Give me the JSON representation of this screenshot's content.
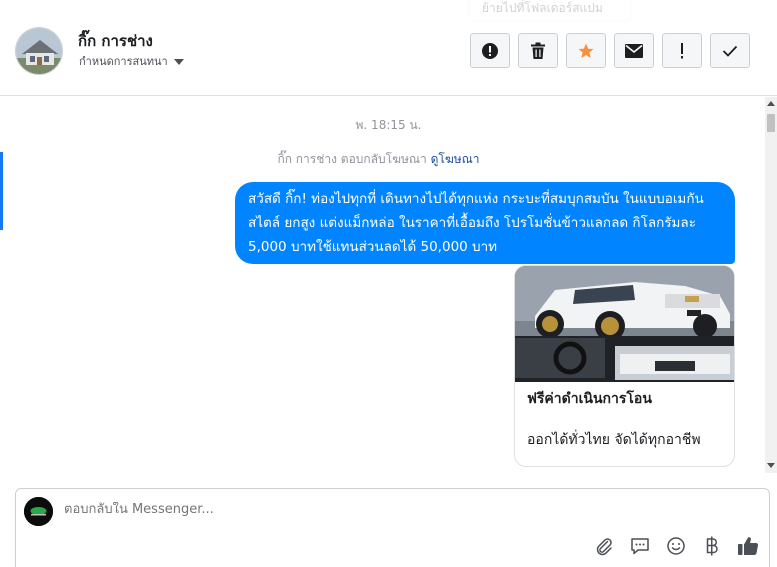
{
  "header": {
    "contact_name": "กิ๊ก การช่าง",
    "conversation_menu_label": "กำหนดการสนทนา",
    "tooltip_text": "ย้ายไปที่โฟลเดอร์สแปม"
  },
  "actions": [
    {
      "name": "report",
      "icon": "exclamation-circle-icon"
    },
    {
      "name": "delete",
      "icon": "trash-icon"
    },
    {
      "name": "star",
      "icon": "star-icon",
      "color": "#f7923b"
    },
    {
      "name": "mark-unread",
      "icon": "envelope-icon"
    },
    {
      "name": "mark-spam",
      "icon": "exclamation-icon"
    },
    {
      "name": "mark-done",
      "icon": "check-icon"
    }
  ],
  "conversation": {
    "timestamp": "พ. 18:15 น.",
    "reply_note_prefix": "กิ๊ก การช่าง ตอบกลับโฆษณา",
    "reply_note_link": "ดูโฆษณา",
    "message_text": "สวัสดี กิ๊ก! ท่องไปทุกที่ เดินทางไปได้ทุกแห่ง กระบะที่สมบุกสมบัน ในแบบอเมกันสไตล์ ยกสูง แต่งแม็กหล่อ ในราคาที่เอื้อมถึง โปรโมชั่นข้าวแลกลด กิโลกรัมละ 5,000 บาทใช้แทนส่วนลดได้ 50,000 บาท",
    "card": {
      "title": "ฟรีค่าดำเนินการโอน",
      "subtitle": "ออกได้ทั่วไทย จัดได้ทุกอาชีพ"
    }
  },
  "composer": {
    "placeholder": "ตอบกลับใน Messenger..."
  },
  "colors": {
    "bubble": "#0084ff",
    "accent": "#1877f2",
    "star": "#f7923b"
  }
}
